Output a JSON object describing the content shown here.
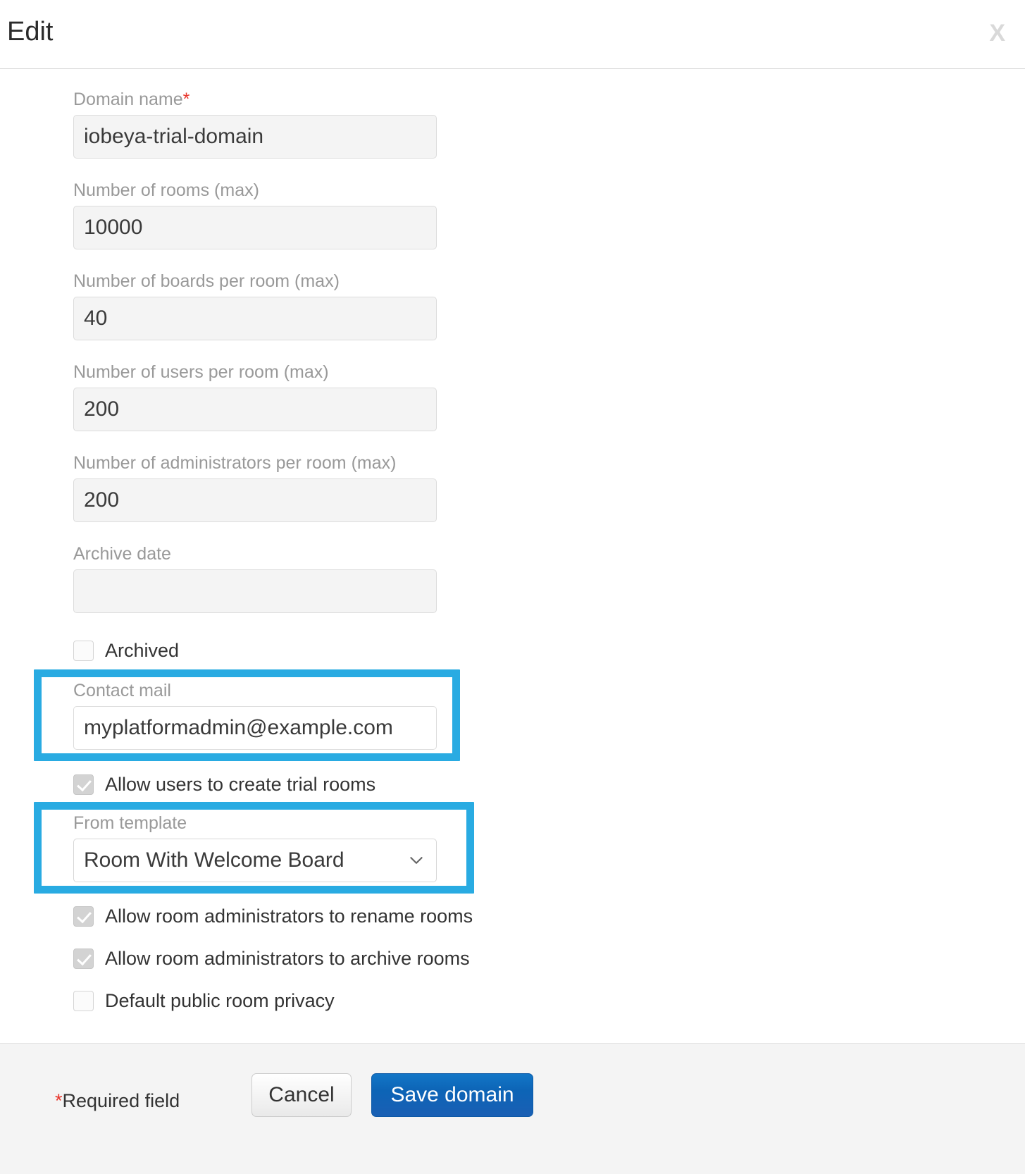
{
  "dialog": {
    "title": "Edit",
    "close_label": "X"
  },
  "fields": {
    "domain_name": {
      "label": "Domain name",
      "required_marker": "*",
      "value": "iobeya-trial-domain",
      "placeholder": ""
    },
    "rooms_max": {
      "label": "Number of rooms (max)",
      "value": "10000",
      "placeholder": ""
    },
    "boards_per_room_max": {
      "label": "Number of boards per room (max)",
      "value": "40",
      "placeholder": ""
    },
    "users_per_room_max": {
      "label": "Number of users per room (max)",
      "value": "200",
      "placeholder": ""
    },
    "admins_per_room_max": {
      "label": "Number of administrators per room (max)",
      "value": "200",
      "placeholder": ""
    },
    "archive_date": {
      "label": "Archive date",
      "value": "",
      "placeholder": ""
    },
    "contact_mail": {
      "label": "Contact mail",
      "value": "myplatformadmin@example.com",
      "placeholder": ""
    },
    "from_template": {
      "label": "From template",
      "value": "Room With Welcome Board"
    }
  },
  "checkboxes": [
    {
      "key": "archived",
      "label": "Archived",
      "checked": false
    },
    {
      "key": "allow_trial_rooms",
      "label": "Allow users to create trial rooms",
      "checked": true
    },
    {
      "key": "allow_rename_rooms",
      "label": "Allow room administrators to rename rooms",
      "checked": true
    },
    {
      "key": "allow_archive_rooms",
      "label": "Allow room administrators to archive rooms",
      "checked": true
    },
    {
      "key": "default_public_privacy",
      "label": "Default public room privacy",
      "checked": false
    }
  ],
  "footer": {
    "required_star": "*",
    "required_text": "Required field",
    "cancel_label": "Cancel",
    "save_label": "Save domain"
  },
  "colors": {
    "highlight": "#29abe2",
    "required_star": "#e8342a",
    "primary_button": "#0d64b6"
  }
}
